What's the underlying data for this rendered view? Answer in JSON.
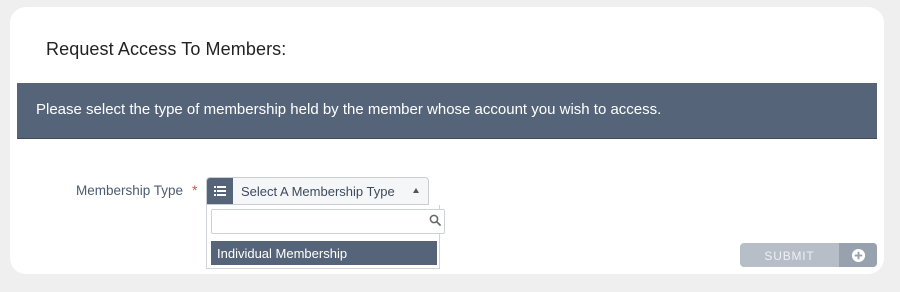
{
  "page": {
    "title": "Request Access To Members:"
  },
  "banner": {
    "message": "Please select the type of membership held by the member whose account you wish to access."
  },
  "form": {
    "membership_type": {
      "label": "Membership Type",
      "required_marker": "*",
      "selected_value": "Select A Membership Type",
      "search_value": "",
      "options": [
        "Individual Membership"
      ]
    },
    "submit_label": "SUBMIT"
  },
  "icons": {
    "select": "list-icon",
    "search": "search-icon",
    "submit": "plus-circle-icon"
  },
  "colors": {
    "accent": "#56647a",
    "required": "#d9534f",
    "submit_disabled": "#b8bec8"
  }
}
